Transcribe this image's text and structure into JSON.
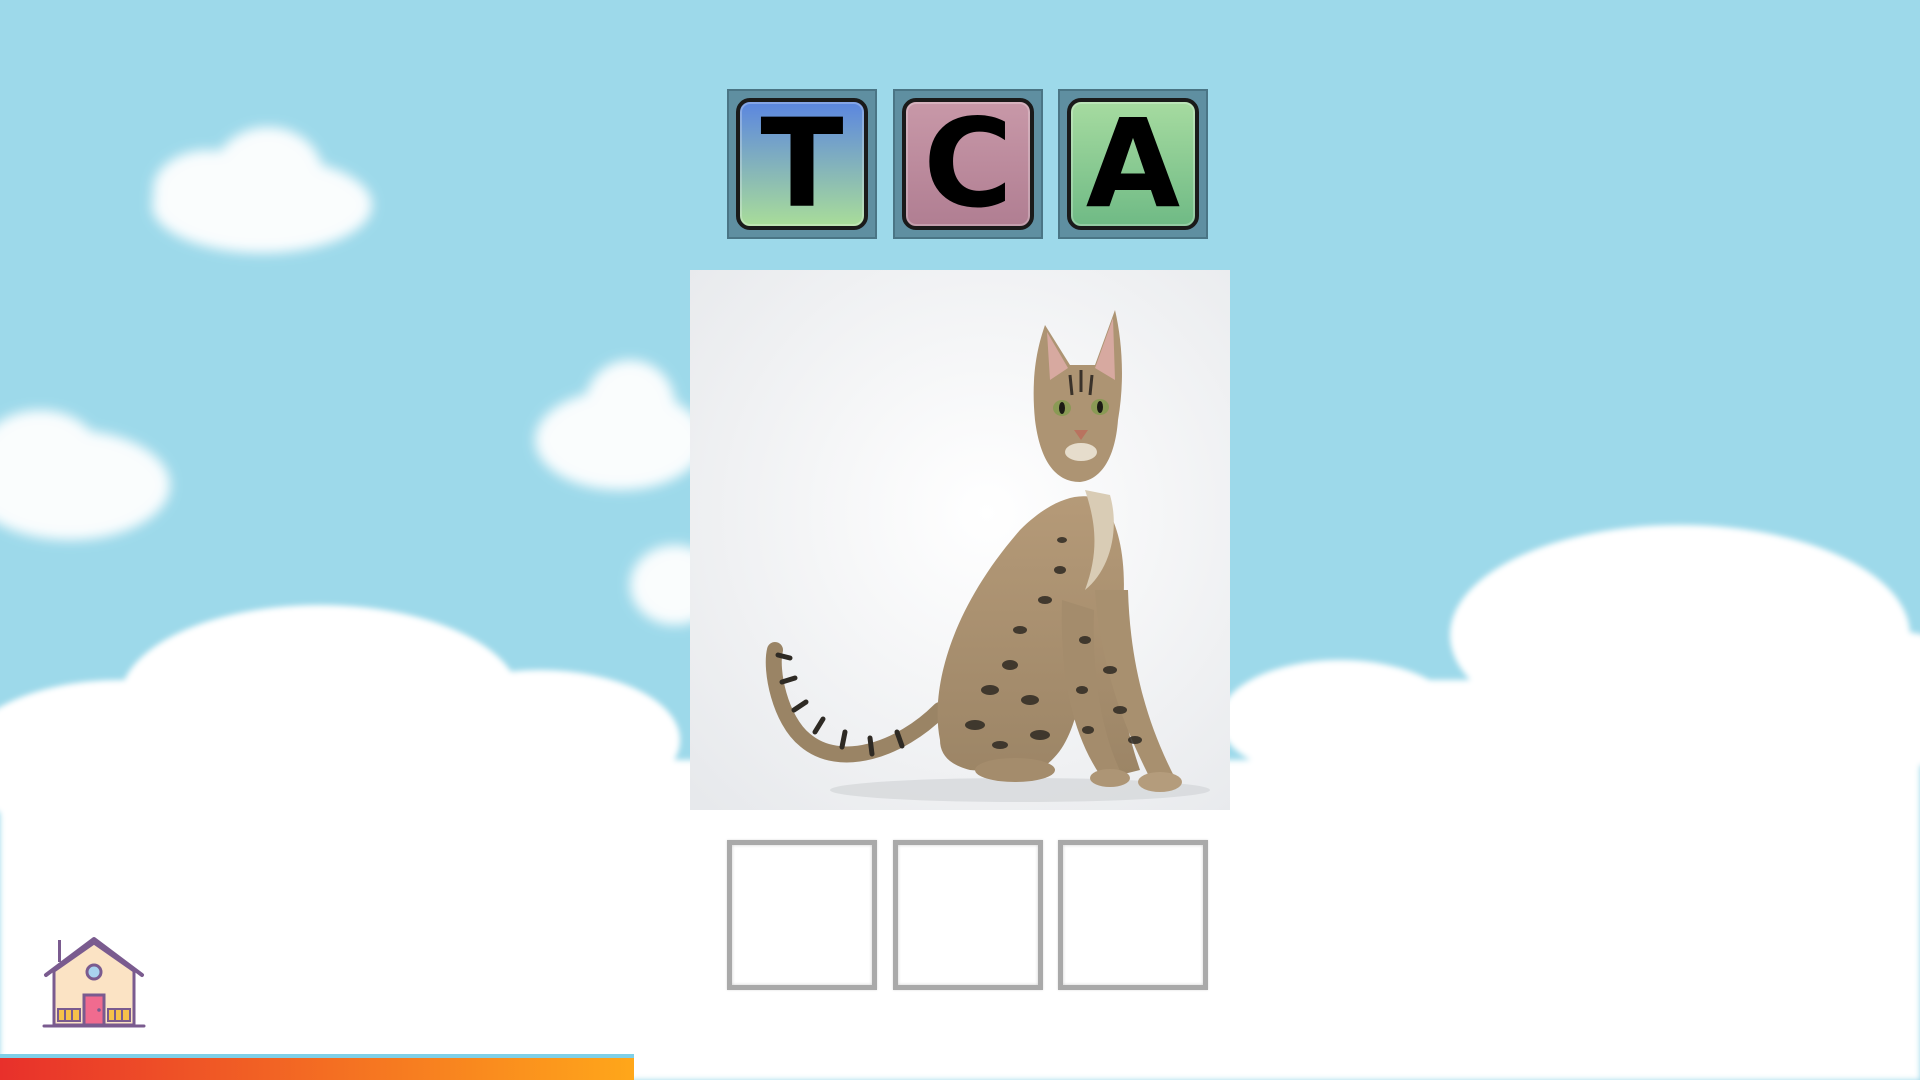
{
  "game": {
    "letter_tiles": [
      {
        "letter": "T",
        "colors": [
          "#5b86e0",
          "#a9dd99"
        ]
      },
      {
        "letter": "C",
        "colors": [
          "#c898a8",
          "#b07e92"
        ]
      },
      {
        "letter": "A",
        "colors": [
          "#a6dba0",
          "#6fba85"
        ]
      }
    ],
    "answer_slots": [
      "",
      "",
      ""
    ],
    "image_icon": "cat-photo",
    "home_icon": "home-icon",
    "progress": 0.33,
    "progress_colors": [
      "#e8302b",
      "#ffa71a"
    ],
    "sky_color": "#9dd9ea"
  }
}
